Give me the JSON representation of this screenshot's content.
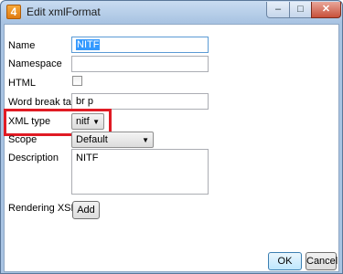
{
  "window": {
    "title": "Edit xmlFormat",
    "app_icon_glyph": "4",
    "close_glyph": "✕",
    "minimize_glyph": "–",
    "maximize_glyph": "□"
  },
  "form": {
    "name_label": "Name",
    "name_value": "NITF",
    "namespace_label": "Namespace",
    "namespace_value": "",
    "html_label": "HTML",
    "html_checked": false,
    "word_break_label": "Word break tags",
    "word_break_value": "br p",
    "xml_type_label": "XML type",
    "xml_type_value": "nitf",
    "scope_label": "Scope",
    "scope_value": "Default",
    "description_label": "Description",
    "description_value": "NITF",
    "rendering_label": "Rendering XSLs",
    "add_label": "Add"
  },
  "buttons": {
    "ok_label": "OK",
    "cancel_label": "Cancel"
  },
  "colors": {
    "highlight": "#e01b24",
    "selection": "#3399ff"
  },
  "icons": {
    "combo_arrow": "▼"
  }
}
